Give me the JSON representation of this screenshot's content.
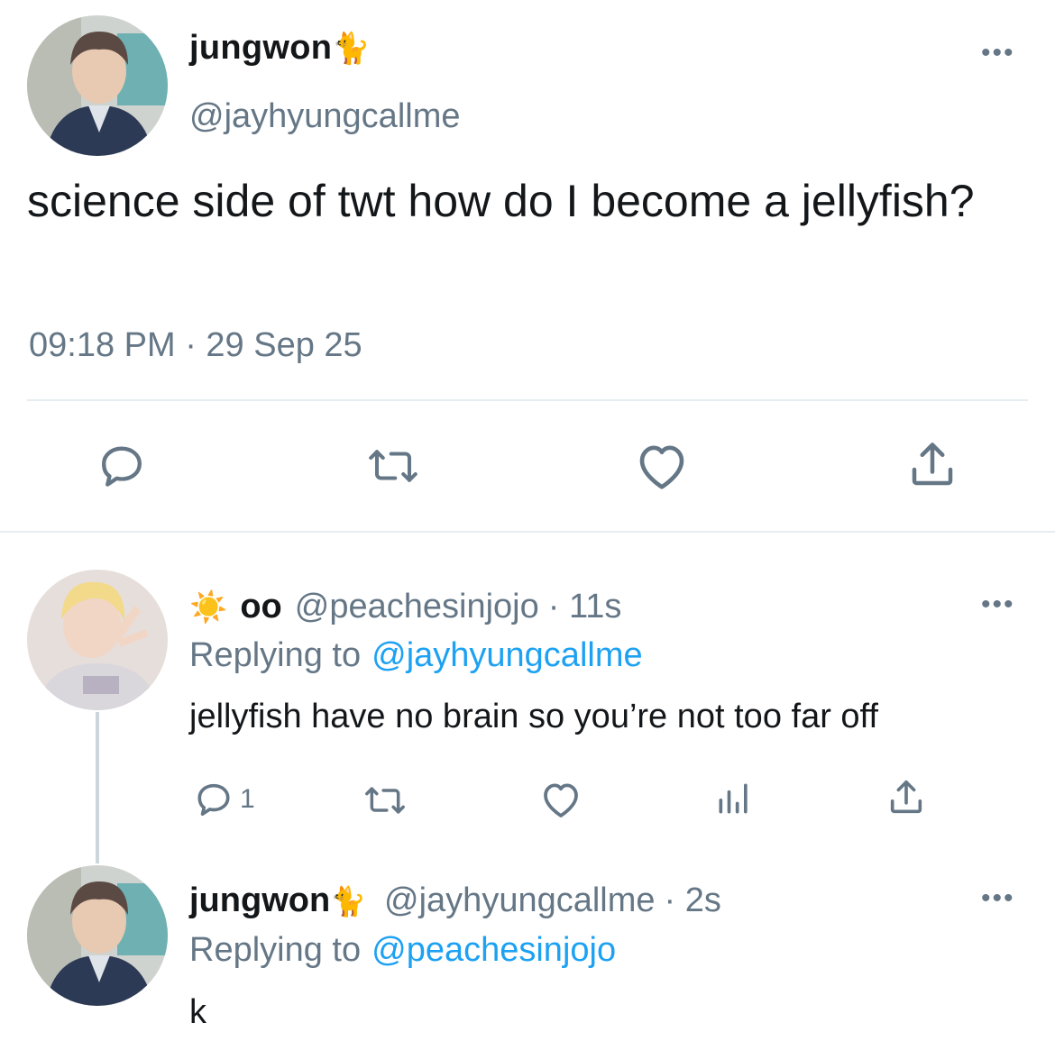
{
  "main_tweet": {
    "display_name": "jungwon",
    "name_emoji": "🐈",
    "handle": "@jayhyungcallme",
    "text": "science side of twt how do I become a jellyfish?",
    "timestamp": "09:18 PM · 29 Sep 25",
    "more": "•••"
  },
  "replies": [
    {
      "prefix_emoji": "☀️",
      "display_name": "oo",
      "handle": "@peachesinjojo",
      "time": "· 11s",
      "replying_label": "Replying to",
      "replying_to": "@jayhyungcallme",
      "text": "jellyfish have no brain so you’re not too far off",
      "reply_count": "1",
      "more": "•••"
    },
    {
      "display_name": "jungwon",
      "name_emoji": "🐈",
      "handle": "@jayhyungcallme",
      "time": "· 2s",
      "replying_label": "Replying to",
      "replying_to": "@peachesinjojo",
      "text": "k",
      "more": "•••"
    }
  ],
  "icons": [
    "reply-icon",
    "retweet-icon",
    "like-icon",
    "share-icon",
    "analytics-icon"
  ],
  "colors": {
    "text": "#14171a",
    "secondary": "#657786",
    "link": "#1da1f2",
    "divider": "#e6ecf0",
    "thread_line": "#ccd6dd"
  }
}
